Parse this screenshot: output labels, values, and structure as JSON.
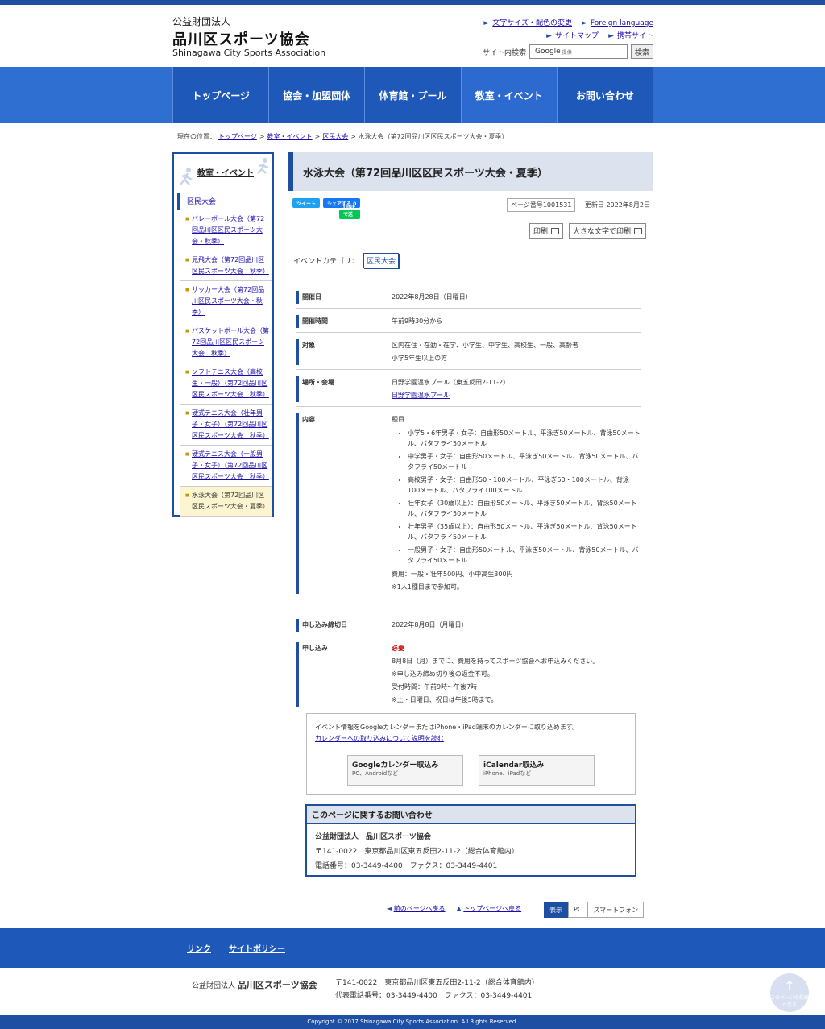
{
  "header": {
    "org_type": "公益財団法人",
    "org_name": "品川区スポーツ協会",
    "org_en": "Shinagawa City Sports Association",
    "links": [
      "文字サイズ・配色の変更",
      "Foreign language",
      "サイトマップ",
      "携帯サイト"
    ],
    "search_label": "サイト内検索",
    "search_brand": "Google",
    "search_brand_sub": "提供",
    "search_button": "検索"
  },
  "nav": [
    "トップページ",
    "協会・加盟団体",
    "体育館・プール",
    "教室・イベント",
    "お問い合わせ"
  ],
  "breadcrumb": {
    "prefix": "現在の位置：",
    "items": [
      "トップページ",
      "教室・イベント",
      "区民大会"
    ],
    "current": "水泳大会（第72回品川区区民スポーツ大会・夏季）"
  },
  "sidebar": {
    "title": "教室・イベント",
    "category": "区民大会",
    "items": [
      "バレーボール大会（第72回品川区区民スポーツ大会・秋季）",
      "見飛大会（第72回品川区区民スポーツ大会　秋季）",
      "サッカー大会（第72回品川区民スポーツ大会・秋季）",
      "バスケットボール大会（第72回品川区区民スポーツ大会　秋季）",
      "ソフトテニス大会（高校生・一般）（第72回品川区区民スポーツ大会　秋季）",
      "硬式テニス大会（壮年男子・女子）（第72回品川区区民スポーツ大会　秋季）",
      "硬式テニス大会（一般男子・女子）（第72回品川区区民スポーツ大会　秋季）",
      "水泳大会（第72回品川区区民スポーツ大会・夏季）"
    ]
  },
  "main": {
    "title": "水泳大会（第72回品川区区民スポーツ大会・夏季）",
    "tweet": "ツイート",
    "share": "シェアする 0",
    "line": "LINEで送る",
    "page_no": "ページ番号1001531",
    "updated": "更新日 2022年8月2日",
    "print": "印刷",
    "print_large": "大きな文字で印刷",
    "event_cat_label": "イベントカテゴリ：",
    "event_cat": "区民大会",
    "rows": {
      "date_h": "開催日",
      "date": "2022年8月28日（日曜日）",
      "time_h": "開催時間",
      "time": "午前9時30分から",
      "target_h": "対象",
      "target1": "区内在住・在勤・在学、小学生、中学生、高校生、一般、高齢者",
      "target2": "小学5年生以上の方",
      "place_h": "場所・会場",
      "place1": "日野学園温水プール（東五反田2-11-2）",
      "place2": "日野学園温水プール",
      "content_h": "内容",
      "content_intro": "種目",
      "events": [
        "小学5・6年男子・女子：自由形50メートル、平泳ぎ50メートル、背泳50メートル、バタフライ50メートル",
        "中学男子・女子：自由形50メートル、平泳ぎ50メートル、背泳50メートル、バタフライ50メートル",
        "高校男子・女子：自由形50・100メートル、平泳ぎ50・100メートル、背泳100メートル、バタフライ100メートル",
        "壮年女子（30歳以上）：自由形50メートル、平泳ぎ50メートル、背泳50メートル、バタフライ50メートル",
        "壮年男子（35歳以上）：自由形50メートル、平泳ぎ50メートル、背泳50メートル、バタフライ50メートル",
        "一般男子・女子：自由形50メートル、平泳ぎ50メートル、背泳50メートル、バタフライ50メートル"
      ],
      "fee": "費用：一般・壮年500円、小中高生300円",
      "fee_note": "※1人1種目まで参加可。",
      "deadline_h": "申し込み締切日",
      "deadline": "2022年8月8日（月曜日）",
      "apply_h": "申し込み",
      "apply_req": "必要",
      "apply1": "8月8日（月）までに、費用を持ってスポーツ協会へお申込みください。",
      "apply2": "※申し込み締め切り後の返金不可。",
      "apply3": "受付時間：午前9時～午後7時",
      "apply4": "※土・日曜日、祝日は午後5時まで。"
    }
  },
  "calendar": {
    "text": "イベント情報をGoogleカレンダーまたはiPhone・iPad端末のカレンダーに取り込めます。",
    "link": "カレンダーへの取り込みについて説明を読む",
    "google": "Googleカレンダー取込み",
    "google_sub": "PC、Androidなど",
    "ical": "iCalendar取込み",
    "ical_sub": "iPhone、iPadなど"
  },
  "contact": {
    "title": "このページに関するお問い合わせ",
    "name": "公益財団法人　品川区スポーツ協会",
    "addr": "〒141-0022　東京都品川区東五反田2-11-2（総合体育館内）",
    "tel": "電話番号：03-3449-4400　ファクス：03-3449-4401"
  },
  "pagenav": {
    "back": "前のページへ戻る",
    "top": "トップページへ戻る",
    "display": "表示",
    "pc": "PC",
    "sp": "スマートフォン"
  },
  "footer": {
    "links": [
      "リンク",
      "サイトポリシー"
    ],
    "org_type": "公益財団法人",
    "org_name": "品川区スポーツ協会",
    "addr": "〒141-0022　東京都品川区東五反田2-11-2（総合体育館内）",
    "tel": "代表電話番号：03-3449-4400　ファクス：03-3449-4401",
    "copyright": "Copyright © 2017 Shinagawa City Sports Association. All Rights Reserved.",
    "to_top": "このページの先頭へ戻る"
  }
}
